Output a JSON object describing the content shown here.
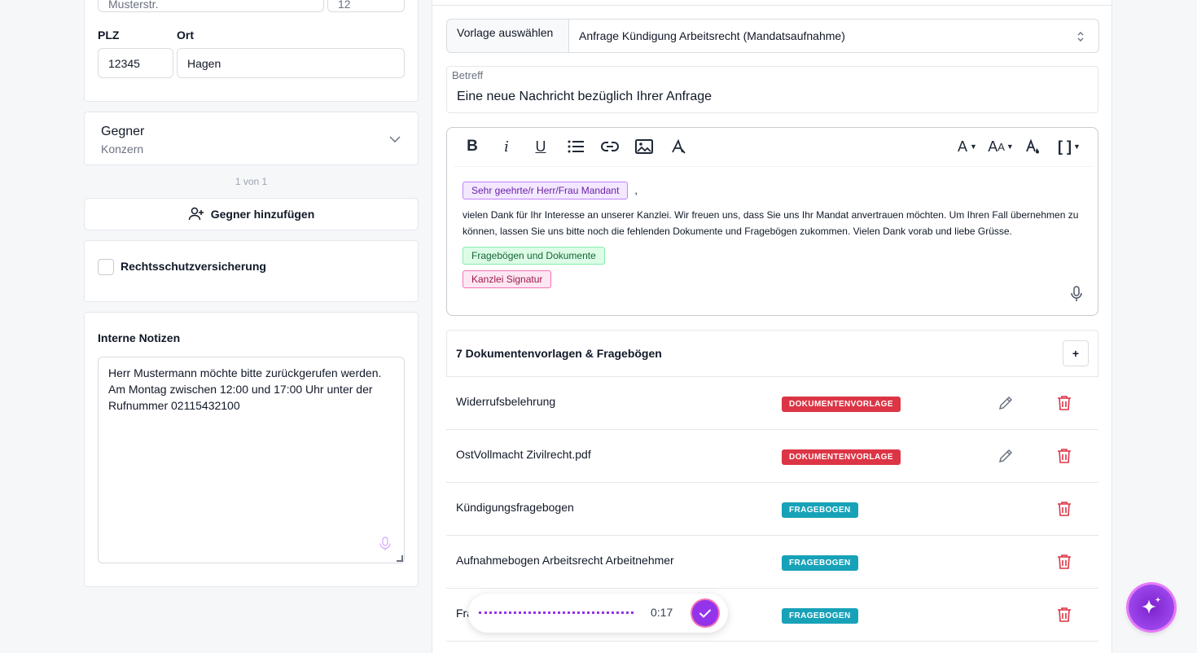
{
  "left": {
    "street_value": "Musterstr.",
    "house_value": "12",
    "plz_label": "PLZ",
    "ort_label": "Ort",
    "plz_value": "12345",
    "ort_value": "Hagen",
    "opponent": {
      "title": "Gegner",
      "subtitle": "Konzern",
      "pager": "1 von 1",
      "add_label": "Gegner hinzufügen"
    },
    "insurance_label": "Rechtsschutzversicherung",
    "notes": {
      "title": "Interne Notizen",
      "text": "Herr Mustermann möchte bitte zurückgerufen werden. Am Montag zwischen 12:00 und 17:00 Uhr unter der Rufnummer 02115432100"
    }
  },
  "editor": {
    "template_label": "Vorlage auswählen",
    "template_value": "Anfrage Kündigung Arbeitsrecht (Mandatsaufnahme)",
    "subject_label": "Betreff",
    "subject_value": "Eine neue Nachricht bezüglich Ihrer Anfrage",
    "salutation_tag": "Sehr geehrte/r Herr/Frau Mandant",
    "comma": ",",
    "body_text": "vielen Dank für Ihr Interesse an unserer Kanzlei. Wir freuen uns, dass Sie uns Ihr Mandat anvertrauen möchten. Um Ihren Fall übernehmen zu können, lassen Sie uns bitte noch die fehlenden Dokumente und Fragebögen zukommen. Vielen Dank vorab und liebe Grüsse.",
    "docs_tag": "Fragebögen und Dokumente",
    "signature_tag": "Kanzlei Signatur"
  },
  "docs": {
    "header": "7 Dokumentenvorlagen & Fragebögen",
    "add_label": "+",
    "rows": [
      {
        "name": "Widerrufsbelehrung",
        "type": "DOKUMENTENVORLAGE"
      },
      {
        "name": "OstVollmacht Zivilrecht.pdf",
        "type": "DOKUMENTENVORLAGE"
      },
      {
        "name": "Kündigungsfragebogen",
        "type": "FRAGEBOGEN"
      },
      {
        "name": "Aufnahmebogen Arbeitsrecht Arbeitnehmer",
        "type": "FRAGEBOGEN"
      },
      {
        "name": "Fra",
        "type": "FRAGEBOGEN"
      }
    ]
  },
  "recorder": {
    "time": "0:17"
  },
  "colors": {
    "accent": "#9333ea",
    "danger": "#dc3545",
    "info": "#17a2b8"
  },
  "icons": [
    "bold-icon",
    "italic-icon",
    "underline-icon",
    "list-icon",
    "link-icon",
    "image-icon",
    "clear-format-icon",
    "font-icon",
    "font-size-icon",
    "font-color-icon",
    "placeholder-icon",
    "mic-icon",
    "edit-icon",
    "trash-icon",
    "sparkle-icon",
    "check-icon",
    "user-plus-icon",
    "chevron-down-icon",
    "select-arrows-icon"
  ]
}
